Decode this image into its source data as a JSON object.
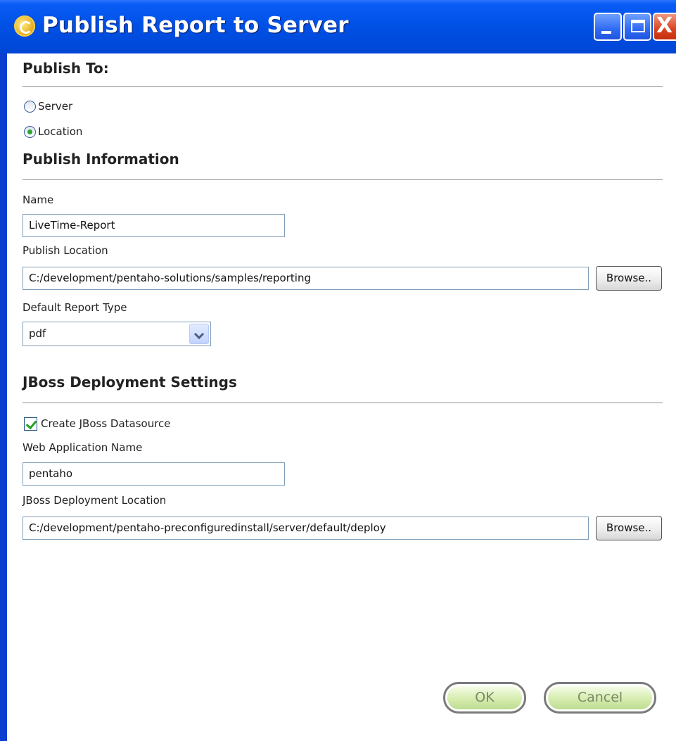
{
  "window": {
    "title": "Publish Report to Server",
    "controls": [
      "minimize-icon",
      "maximize-icon",
      "close-icon"
    ],
    "close_glyph": "X"
  },
  "publish_to": {
    "heading": "Publish To:",
    "options": [
      {
        "label": "Server",
        "selected": false
      },
      {
        "label": "Location",
        "selected": true
      }
    ]
  },
  "publish_information": {
    "heading": "Publish Information",
    "name_label": "Name",
    "name_value": "LiveTime-Report",
    "location_label": "Publish Location",
    "location_value": "C:/development/pentaho-solutions/samples/reporting",
    "browse_label": "Browse..",
    "report_type_label": "Default Report Type",
    "report_type_value": "pdf"
  },
  "jboss": {
    "heading": "JBoss Deployment Settings",
    "create_datasource_label": "Create JBoss Datasource",
    "create_datasource_checked": true,
    "webapp_label": "Web Application Name",
    "webapp_value": "pentaho",
    "deploy_location_label": "JBoss Deployment Location",
    "deploy_location_value": "C:/development/pentaho-preconfiguredinstall/server/default/deploy",
    "browse_label": "Browse.."
  },
  "buttons": {
    "ok_label": "OK",
    "cancel_label": "Cancel"
  },
  "colors": {
    "titlebar": "#0054e3",
    "accent_check": "#21a121",
    "button_fill": "#d9eeb3"
  }
}
